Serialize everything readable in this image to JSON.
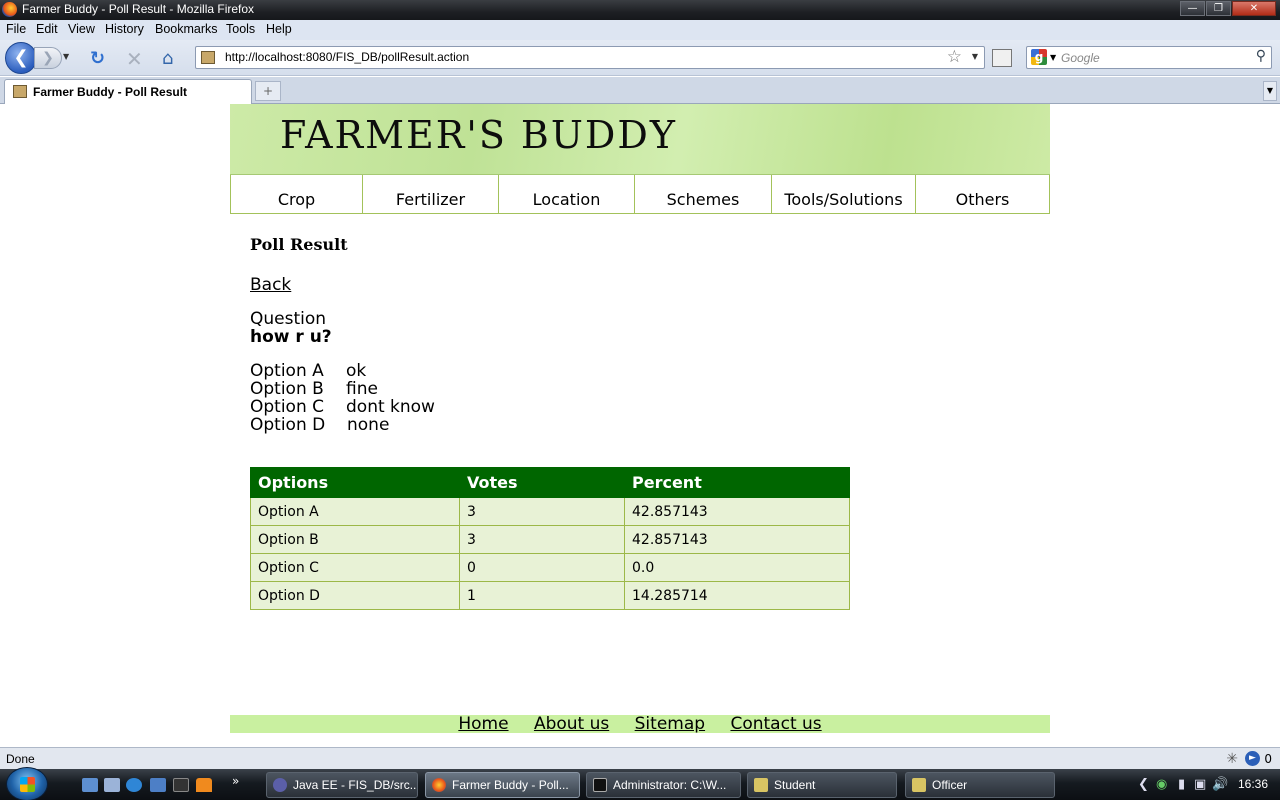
{
  "window": {
    "title": "Farmer Buddy - Poll Result - Mozilla Firefox"
  },
  "menu": [
    "File",
    "Edit",
    "View",
    "History",
    "Bookmarks",
    "Tools",
    "Help"
  ],
  "address_bar": {
    "url": "http://localhost:8080/FIS_DB/pollResult.action"
  },
  "search_bar": {
    "placeholder": "Google"
  },
  "tab": {
    "label": "Farmer Buddy - Poll Result"
  },
  "site": {
    "logo": "FARMER'S BUDDY",
    "nav": [
      "Crop",
      "Fertilizer",
      "Location",
      "Schemes",
      "Tools/Solutions",
      "Others"
    ]
  },
  "page": {
    "heading": "Poll Result",
    "back_link": "Back",
    "question_label": "Question",
    "question": "how r u?",
    "options": [
      {
        "name": "Option A",
        "value": "ok"
      },
      {
        "name": "Option B",
        "value": "fine"
      },
      {
        "name": "Option C",
        "value": "dont know"
      },
      {
        "name": "Option D",
        "value": "none"
      }
    ],
    "table": {
      "headers": [
        "Options",
        "Votes",
        "Percent"
      ],
      "rows": [
        [
          "Option A",
          "3",
          "42.857143"
        ],
        [
          "Option B",
          "3",
          "42.857143"
        ],
        [
          "Option C",
          "0",
          "0.0"
        ],
        [
          "Option D",
          "1",
          "14.285714"
        ]
      ]
    }
  },
  "footer": {
    "links": [
      "Home",
      "About us",
      "Sitemap",
      "Contact us"
    ]
  },
  "status": {
    "text": "Done",
    "count": "0"
  },
  "taskbar": {
    "tasks": [
      "Java EE - FIS_DB/src...",
      "Farmer Buddy - Poll...",
      "Administrator: C:\\W...",
      "Student",
      "Officer"
    ],
    "clock": "16:36"
  },
  "colors": {
    "table_header": "#006600",
    "table_cell": "#e8f2d6",
    "banner": "#c4e49b",
    "footer": "#c9f0a0"
  }
}
